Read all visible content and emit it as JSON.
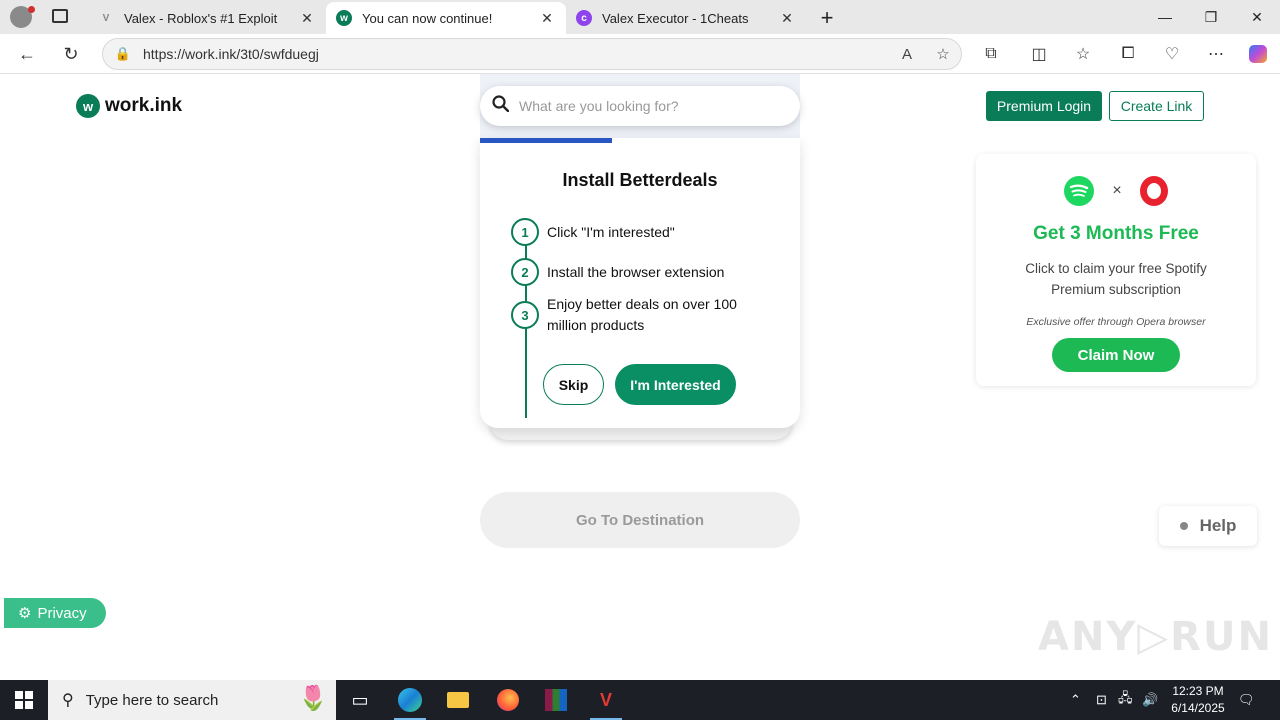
{
  "browser": {
    "tabs": [
      {
        "title": "Valex - Roblox's #1 Exploit",
        "active": false
      },
      {
        "title": "You can now continue!",
        "active": true
      },
      {
        "title": "Valex Executor - 1Cheats",
        "active": false
      }
    ],
    "new_tab": "+",
    "url": "https://work.ink/3t0/swfduegj",
    "window_controls": {
      "minimize": "—",
      "restore": "❐",
      "close": "✕"
    }
  },
  "page": {
    "logo_mark": "w",
    "logo_text": "work.ink",
    "search_placeholder": "What are you looking for?",
    "premium_login": "Premium Login",
    "create_link": "Create Link",
    "offer": {
      "title": "Install Betterdeals",
      "steps": [
        {
          "num": "1",
          "text": "Click \"I'm interested\""
        },
        {
          "num": "2",
          "text": "Install the browser extension"
        },
        {
          "num": "3",
          "text": "Enjoy better deals on over 100 million products"
        }
      ],
      "skip": "Skip",
      "interested": "I'm Interested"
    },
    "go_to_destination": "Go To Destination",
    "ad": {
      "x": "×",
      "title": "Get 3 Months Free",
      "description": "Click to claim your free Spotify Premium subscription",
      "note": "Exclusive offer through Opera browser",
      "cta": "Claim Now"
    },
    "help": "Help",
    "privacy": "Privacy",
    "watermark": "ANY▷RUN"
  },
  "taskbar": {
    "search_placeholder": "Type here to search",
    "time": "12:23 PM",
    "date": "6/14/2025"
  },
  "colors": {
    "brand_green": "#0a7c57",
    "spotify_green": "#1db954",
    "progress_blue": "#2857c4",
    "opera_red": "#e8232f"
  }
}
